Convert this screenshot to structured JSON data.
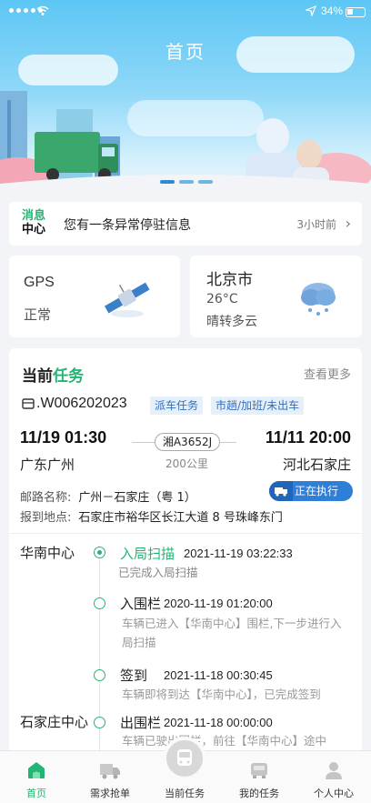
{
  "status_bar": {
    "battery": "34%"
  },
  "header": {
    "title": "首页"
  },
  "message": {
    "tag_line1": "消息",
    "tag_line2": "中心",
    "text": "您有一条异常停驻信息",
    "time": "3小时前"
  },
  "gps": {
    "label": "GPS",
    "status": "正常"
  },
  "weather": {
    "city": "北京市",
    "temperature": "26°C",
    "description": "晴转多云"
  },
  "task": {
    "title_prefix": "当前",
    "title_highlight": "任务",
    "more": "查看更多",
    "waybill": ".W006202023",
    "tags": [
      "派车任务",
      "市趟/加班/未出车"
    ],
    "depart_time": "11/19 01:30",
    "arrive_time": "11/11 20:00",
    "origin": "广东广州",
    "destination": "河北石家庄",
    "plate": "湘A3652J",
    "distance": "200公里",
    "status": "正在执行",
    "route_label": "邮路名称:",
    "route_value": "广州－石家庄（粤 1）",
    "report_label": "报到地点:",
    "report_value": "石家庄市裕华区长江大道 8 号珠峰东门"
  },
  "timeline": [
    {
      "hub": "华南中心",
      "event": "入局扫描",
      "time": "2021-11-19 03:22:33",
      "desc": "已完成入局扫描",
      "active": true
    },
    {
      "hub": "",
      "event": "入围栏",
      "time": "2020-11-19 01:20:00",
      "desc": "车辆已进入【华南中心】围栏,下一步进行入局扫描",
      "active": false
    },
    {
      "hub": "",
      "event": "签到",
      "time": "2021-11-18 00:30:45",
      "desc": "车辆即将到达【华南中心】，已完成签到",
      "active": false
    },
    {
      "hub": "石家庄中心",
      "event": "出围栏",
      "time": "2021-11-18 00:00:00",
      "desc": "车辆已驶出围栏，前往【华南中心】途中",
      "active": false
    }
  ],
  "nav": [
    {
      "label": "首页",
      "icon": "home-icon",
      "active": true
    },
    {
      "label": "需求抢单",
      "icon": "truck-icon",
      "active": false
    },
    {
      "label": "当前任务",
      "icon": "bus-icon",
      "active": false
    },
    {
      "label": "我的任务",
      "icon": "task-car-icon",
      "active": false
    },
    {
      "label": "个人中心",
      "icon": "user-icon",
      "active": false
    }
  ],
  "colors": {
    "accent": "#22b573",
    "primary": "#2f7ed8",
    "sky": "#5cc6f4"
  }
}
